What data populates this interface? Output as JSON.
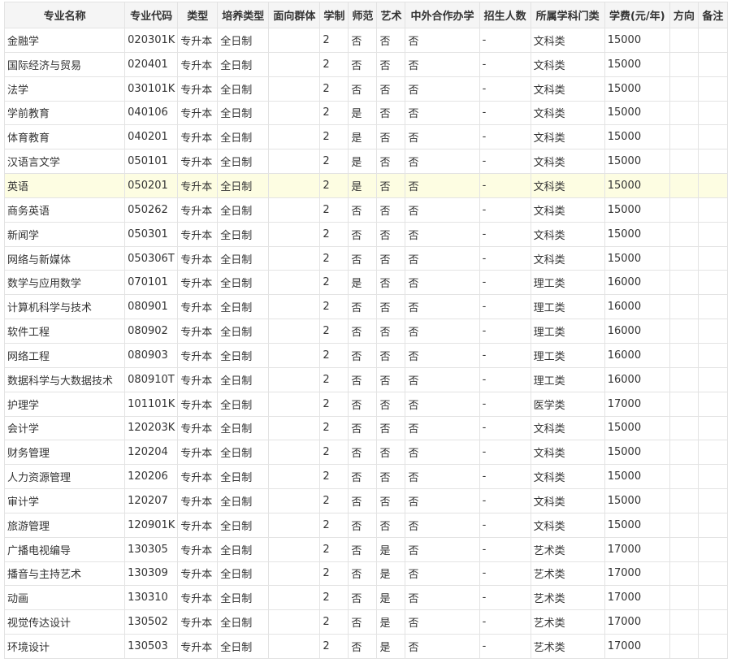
{
  "headers": [
    "专业名称",
    "专业代码",
    "类型",
    "培养类型",
    "面向群体",
    "学制",
    "师范",
    "艺术",
    "中外合作办学",
    "招生人数",
    "所属学科门类",
    "学费(元/年)",
    "方向",
    "备注"
  ],
  "rows": [
    [
      "金融学",
      "020301K",
      "专升本",
      "全日制",
      "",
      "2",
      "否",
      "否",
      "否",
      "-",
      "文科类",
      "15000",
      "",
      ""
    ],
    [
      "国际经济与贸易",
      "020401",
      "专升本",
      "全日制",
      "",
      "2",
      "否",
      "否",
      "否",
      "-",
      "文科类",
      "15000",
      "",
      ""
    ],
    [
      "法学",
      "030101K",
      "专升本",
      "全日制",
      "",
      "2",
      "否",
      "否",
      "否",
      "-",
      "文科类",
      "15000",
      "",
      ""
    ],
    [
      "学前教育",
      "040106",
      "专升本",
      "全日制",
      "",
      "2",
      "是",
      "否",
      "否",
      "-",
      "文科类",
      "15000",
      "",
      ""
    ],
    [
      "体育教育",
      "040201",
      "专升本",
      "全日制",
      "",
      "2",
      "是",
      "否",
      "否",
      "-",
      "文科类",
      "15000",
      "",
      ""
    ],
    [
      "汉语言文学",
      "050101",
      "专升本",
      "全日制",
      "",
      "2",
      "是",
      "否",
      "否",
      "-",
      "文科类",
      "15000",
      "",
      ""
    ],
    [
      "英语",
      "050201",
      "专升本",
      "全日制",
      "",
      "2",
      "是",
      "否",
      "否",
      "-",
      "文科类",
      "15000",
      "",
      ""
    ],
    [
      "商务英语",
      "050262",
      "专升本",
      "全日制",
      "",
      "2",
      "否",
      "否",
      "否",
      "-",
      "文科类",
      "15000",
      "",
      ""
    ],
    [
      "新闻学",
      "050301",
      "专升本",
      "全日制",
      "",
      "2",
      "否",
      "否",
      "否",
      "-",
      "文科类",
      "15000",
      "",
      ""
    ],
    [
      "网络与新媒体",
      "050306T",
      "专升本",
      "全日制",
      "",
      "2",
      "否",
      "否",
      "否",
      "-",
      "文科类",
      "15000",
      "",
      ""
    ],
    [
      "数学与应用数学",
      "070101",
      "专升本",
      "全日制",
      "",
      "2",
      "是",
      "否",
      "否",
      "-",
      "理工类",
      "16000",
      "",
      ""
    ],
    [
      "计算机科学与技术",
      "080901",
      "专升本",
      "全日制",
      "",
      "2",
      "否",
      "否",
      "否",
      "-",
      "理工类",
      "16000",
      "",
      ""
    ],
    [
      "软件工程",
      "080902",
      "专升本",
      "全日制",
      "",
      "2",
      "否",
      "否",
      "否",
      "-",
      "理工类",
      "16000",
      "",
      ""
    ],
    [
      "网络工程",
      "080903",
      "专升本",
      "全日制",
      "",
      "2",
      "否",
      "否",
      "否",
      "-",
      "理工类",
      "16000",
      "",
      ""
    ],
    [
      "数据科学与大数据技术",
      "080910T",
      "专升本",
      "全日制",
      "",
      "2",
      "否",
      "否",
      "否",
      "-",
      "理工类",
      "16000",
      "",
      ""
    ],
    [
      "护理学",
      "101101K",
      "专升本",
      "全日制",
      "",
      "2",
      "否",
      "否",
      "否",
      "-",
      "医学类",
      "17000",
      "",
      ""
    ],
    [
      "会计学",
      "120203K",
      "专升本",
      "全日制",
      "",
      "2",
      "否",
      "否",
      "否",
      "-",
      "文科类",
      "15000",
      "",
      ""
    ],
    [
      "财务管理",
      "120204",
      "专升本",
      "全日制",
      "",
      "2",
      "否",
      "否",
      "否",
      "-",
      "文科类",
      "15000",
      "",
      ""
    ],
    [
      "人力资源管理",
      "120206",
      "专升本",
      "全日制",
      "",
      "2",
      "否",
      "否",
      "否",
      "-",
      "文科类",
      "15000",
      "",
      ""
    ],
    [
      "审计学",
      "120207",
      "专升本",
      "全日制",
      "",
      "2",
      "否",
      "否",
      "否",
      "-",
      "文科类",
      "15000",
      "",
      ""
    ],
    [
      "旅游管理",
      "120901K",
      "专升本",
      "全日制",
      "",
      "2",
      "否",
      "否",
      "否",
      "-",
      "文科类",
      "15000",
      "",
      ""
    ],
    [
      "广播电视编导",
      "130305",
      "专升本",
      "全日制",
      "",
      "2",
      "否",
      "是",
      "否",
      "-",
      "艺术类",
      "17000",
      "",
      ""
    ],
    [
      "播音与主持艺术",
      "130309",
      "专升本",
      "全日制",
      "",
      "2",
      "否",
      "是",
      "否",
      "-",
      "艺术类",
      "17000",
      "",
      ""
    ],
    [
      "动画",
      "130310",
      "专升本",
      "全日制",
      "",
      "2",
      "否",
      "是",
      "否",
      "-",
      "艺术类",
      "17000",
      "",
      ""
    ],
    [
      "视觉传达设计",
      "130502",
      "专升本",
      "全日制",
      "",
      "2",
      "否",
      "是",
      "否",
      "-",
      "艺术类",
      "17000",
      "",
      ""
    ],
    [
      "环境设计",
      "130503",
      "专升本",
      "全日制",
      "",
      "2",
      "否",
      "是",
      "否",
      "-",
      "艺术类",
      "17000",
      "",
      ""
    ]
  ],
  "highlighted_row": 6
}
